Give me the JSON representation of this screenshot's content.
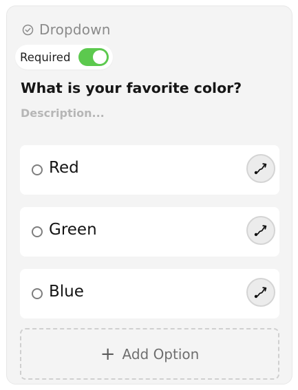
{
  "field": {
    "type_label": "Dropdown",
    "type_icon": "check-circle-icon",
    "required_label": "Required",
    "required_on": true,
    "question": "What is your favorite color?",
    "description_placeholder": "Description..."
  },
  "options": [
    {
      "label": "Red"
    },
    {
      "label": "Green"
    },
    {
      "label": "Blue"
    }
  ],
  "add_option_label": "Add Option",
  "colors": {
    "toggle_on": "#5cc94e",
    "card_bg": "#f4f4f4"
  }
}
